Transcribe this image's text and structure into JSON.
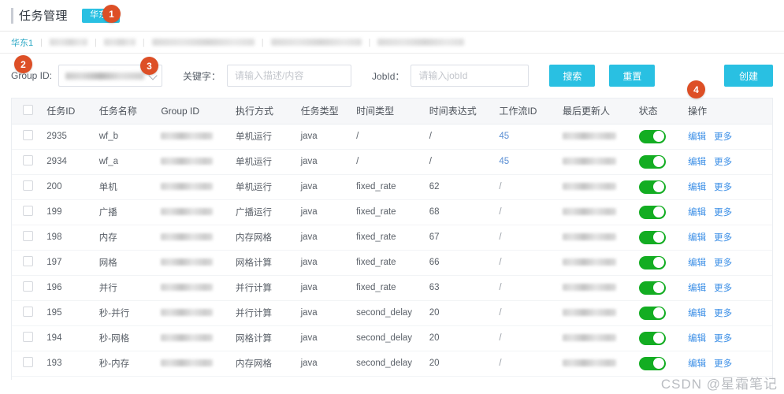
{
  "header": {
    "title": "任务管理",
    "region_badge": "华东1"
  },
  "breadcrumb": {
    "active": "华东1",
    "separator": "|",
    "blurred_items": [
      48,
      40,
      130,
      115,
      110
    ]
  },
  "filters": {
    "group_label": "Group ID:",
    "group_value": "",
    "keyword_label": "关键字：",
    "keyword_value": "",
    "keyword_placeholder": "请输入描述/内容",
    "jobid_label": "JobId：",
    "jobid_value": "",
    "jobid_placeholder": "请输入jobId",
    "search_button": "搜索",
    "reset_button": "重置",
    "create_button": "创建"
  },
  "step_badges": [
    {
      "id": "1",
      "label": "1"
    },
    {
      "id": "2",
      "label": "2"
    },
    {
      "id": "3",
      "label": "3"
    },
    {
      "id": "4",
      "label": "4"
    }
  ],
  "table": {
    "columns": [
      {
        "key": "checkbox",
        "label": ""
      },
      {
        "key": "task_id",
        "label": "任务ID"
      },
      {
        "key": "task_name",
        "label": "任务名称"
      },
      {
        "key": "group_id",
        "label": "Group ID"
      },
      {
        "key": "exec_mode",
        "label": "执行方式"
      },
      {
        "key": "task_type",
        "label": "任务类型"
      },
      {
        "key": "time_type",
        "label": "时间类型"
      },
      {
        "key": "time_expr",
        "label": "时间表达式"
      },
      {
        "key": "workflow_id",
        "label": "工作流ID"
      },
      {
        "key": "last_updater",
        "label": "最后更新人"
      },
      {
        "key": "status",
        "label": "状态"
      },
      {
        "key": "operation",
        "label": "操作"
      }
    ],
    "ops": {
      "edit": "编辑",
      "more": "更多"
    },
    "rows": [
      {
        "task_id": "2935",
        "task_name": "wf_b",
        "exec_mode": "单机运行",
        "task_type": "java",
        "time_type": "/",
        "time_expr": "/",
        "workflow_id": "45",
        "workflow_link": true,
        "status_on": true
      },
      {
        "task_id": "2934",
        "task_name": "wf_a",
        "exec_mode": "单机运行",
        "task_type": "java",
        "time_type": "/",
        "time_expr": "/",
        "workflow_id": "45",
        "workflow_link": true,
        "status_on": true
      },
      {
        "task_id": "200",
        "task_name": "单机",
        "exec_mode": "单机运行",
        "task_type": "java",
        "time_type": "fixed_rate",
        "time_expr": "62",
        "workflow_id": "/",
        "workflow_link": false,
        "status_on": true
      },
      {
        "task_id": "199",
        "task_name": "广播",
        "exec_mode": "广播运行",
        "task_type": "java",
        "time_type": "fixed_rate",
        "time_expr": "68",
        "workflow_id": "/",
        "workflow_link": false,
        "status_on": true
      },
      {
        "task_id": "198",
        "task_name": "内存",
        "exec_mode": "内存网格",
        "task_type": "java",
        "time_type": "fixed_rate",
        "time_expr": "67",
        "workflow_id": "/",
        "workflow_link": false,
        "status_on": true
      },
      {
        "task_id": "197",
        "task_name": "网格",
        "exec_mode": "网格计算",
        "task_type": "java",
        "time_type": "fixed_rate",
        "time_expr": "66",
        "workflow_id": "/",
        "workflow_link": false,
        "status_on": true
      },
      {
        "task_id": "196",
        "task_name": "并行",
        "exec_mode": "并行计算",
        "task_type": "java",
        "time_type": "fixed_rate",
        "time_expr": "63",
        "workflow_id": "/",
        "workflow_link": false,
        "status_on": true
      },
      {
        "task_id": "195",
        "task_name": "秒-并行",
        "exec_mode": "并行计算",
        "task_type": "java",
        "time_type": "second_delay",
        "time_expr": "20",
        "workflow_id": "/",
        "workflow_link": false,
        "status_on": true
      },
      {
        "task_id": "194",
        "task_name": "秒-网格",
        "exec_mode": "网格计算",
        "task_type": "java",
        "time_type": "second_delay",
        "time_expr": "20",
        "workflow_id": "/",
        "workflow_link": false,
        "status_on": true
      },
      {
        "task_id": "193",
        "task_name": "秒-内存",
        "exec_mode": "内存网格",
        "task_type": "java",
        "time_type": "second_delay",
        "time_expr": "20",
        "workflow_id": "/",
        "workflow_link": false,
        "status_on": true
      }
    ]
  },
  "watermark": "CSDN @星霜笔记",
  "colors": {
    "accent": "#29c0e2",
    "badge": "#dd4f26",
    "switch_on": "#13ad22",
    "link": "#3a8ee6"
  }
}
